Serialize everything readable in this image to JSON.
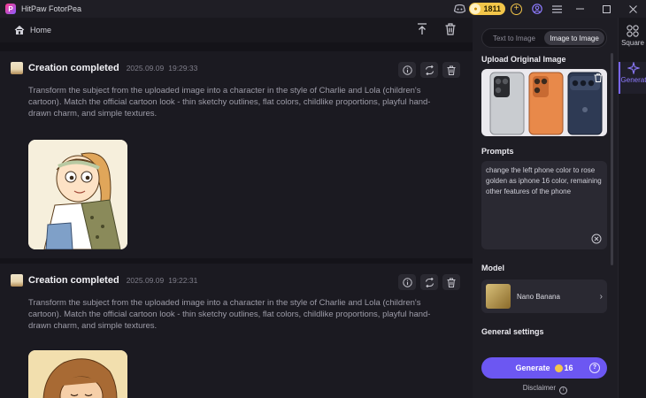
{
  "app": {
    "title": "HitPaw FotorPea",
    "logo_letter": "P"
  },
  "titlebar": {
    "coins": "1811",
    "plus": "+"
  },
  "nav": {
    "home_label": "Home"
  },
  "cards": [
    {
      "title": "Creation completed",
      "date": "2025.09.09",
      "time": "19:29:33",
      "prompt": "Transform the subject from the uploaded image into a character in the style of Charlie and Lola (children's cartoon). Match the official cartoon look - thin sketchy outlines, flat colors, childlike proportions, playful hand-drawn charm, and simple textures."
    },
    {
      "title": "Creation completed",
      "date": "2025.09.09",
      "time": "19:22:31",
      "prompt": "Transform the subject from the uploaded image into a character in the style of Charlie and Lola (children's cartoon). Match the official cartoon look - thin sketchy outlines, flat colors, childlike proportions, playful hand-drawn charm, and simple textures."
    }
  ],
  "panel": {
    "tabs": [
      "Text to Image",
      "Image to Image"
    ],
    "active_tab": "Image to Image",
    "upload_label": "Upload Original Image",
    "prompts_label": "Prompts",
    "prompt_value": "change the left phone color to rose golden as iphone 16 color, remaining other features of the phone",
    "model_label": "Model",
    "model_name": "Nano Banana",
    "general_label": "General settings",
    "generate_label": "Generate",
    "generate_cost": "16",
    "disclaimer": "Disclaimer"
  },
  "rnav": {
    "square": "Square",
    "generate": "Generat"
  },
  "colors": {
    "accent": "#6c57f2",
    "coin": "#f3c64a",
    "bg": "#141319"
  }
}
